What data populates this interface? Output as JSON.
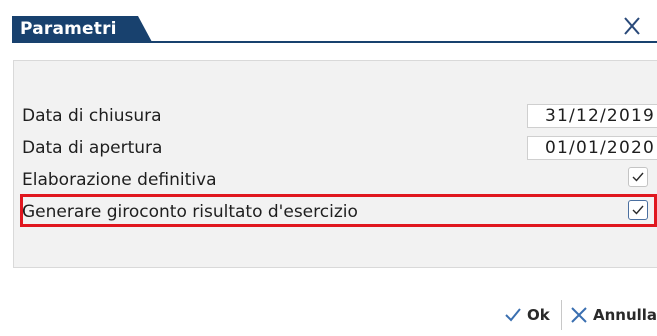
{
  "dialog": {
    "title": "Parametri",
    "close_icon": "close-icon"
  },
  "fields": {
    "closing_date_label": "Data di chiusura",
    "closing_date_value": "31/12/2019",
    "opening_date_label": "Data di apertura",
    "opening_date_value": "01/01/2020",
    "definitive_label": "Elaborazione definitiva",
    "definitive_checked": true,
    "transfer_label": "Generare giroconto risultato d'esercizio",
    "transfer_checked": true
  },
  "footer": {
    "ok_label": "Ok",
    "cancel_label": "Annulla"
  },
  "colors": {
    "title_bar": "#18416e",
    "highlight": "#e0161e",
    "ok_icon": "#3a6fb0",
    "cancel_icon": "#3a6fb0"
  }
}
